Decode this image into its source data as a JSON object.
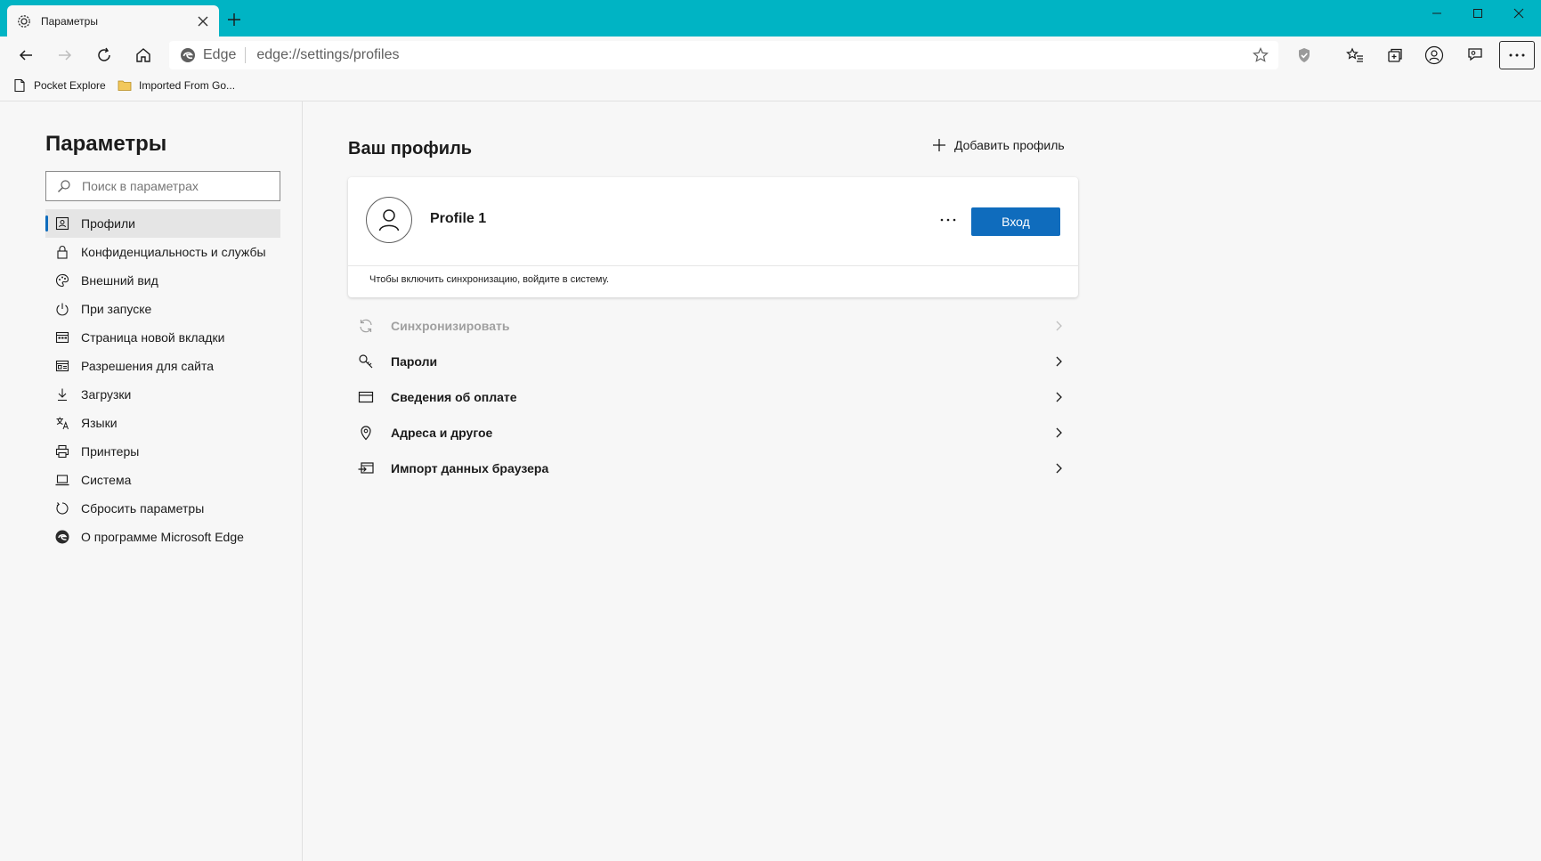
{
  "browser": {
    "tab_title": "Параметры",
    "address_brand": "Edge",
    "address_url": "edge://settings/profiles"
  },
  "bookmarks": [
    {
      "label": "Pocket Explore",
      "icon": "page-icon"
    },
    {
      "label": "Imported From Go...",
      "icon": "folder-icon"
    }
  ],
  "sidebar": {
    "title": "Параметры",
    "search_placeholder": "Поиск в параметрах",
    "items": [
      {
        "label": "Профили",
        "icon": "profile-card-icon",
        "active": true
      },
      {
        "label": "Конфиденциальность и службы",
        "icon": "lock-icon"
      },
      {
        "label": "Внешний вид",
        "icon": "palette-icon"
      },
      {
        "label": "При запуске",
        "icon": "power-icon"
      },
      {
        "label": "Страница новой вкладки",
        "icon": "new-tab-page-icon"
      },
      {
        "label": "Разрешения для сайта",
        "icon": "site-permissions-icon"
      },
      {
        "label": "Загрузки",
        "icon": "download-icon"
      },
      {
        "label": "Языки",
        "icon": "language-icon"
      },
      {
        "label": "Принтеры",
        "icon": "printer-icon"
      },
      {
        "label": "Система",
        "icon": "laptop-icon"
      },
      {
        "label": "Сбросить параметры",
        "icon": "reset-icon"
      },
      {
        "label": "О программе Microsoft Edge",
        "icon": "edge-logo-icon"
      }
    ]
  },
  "main": {
    "title": "Ваш профиль",
    "add_profile_label": "Добавить профиль",
    "profile": {
      "name": "Profile 1",
      "signin_label": "Вход",
      "sync_note": "Чтобы включить синхронизацию, войдите в систему."
    },
    "options": [
      {
        "label": "Синхронизировать",
        "icon": "sync-icon",
        "disabled": true
      },
      {
        "label": "Пароли",
        "icon": "key-icon"
      },
      {
        "label": "Сведения об оплате",
        "icon": "credit-card-icon"
      },
      {
        "label": "Адреса и другое",
        "icon": "location-pin-icon"
      },
      {
        "label": "Импорт данных браузера",
        "icon": "import-icon"
      }
    ]
  },
  "colors": {
    "titlebar": "#00b4c4",
    "accent": "#0f6cbd",
    "background": "#f7f7f7"
  }
}
